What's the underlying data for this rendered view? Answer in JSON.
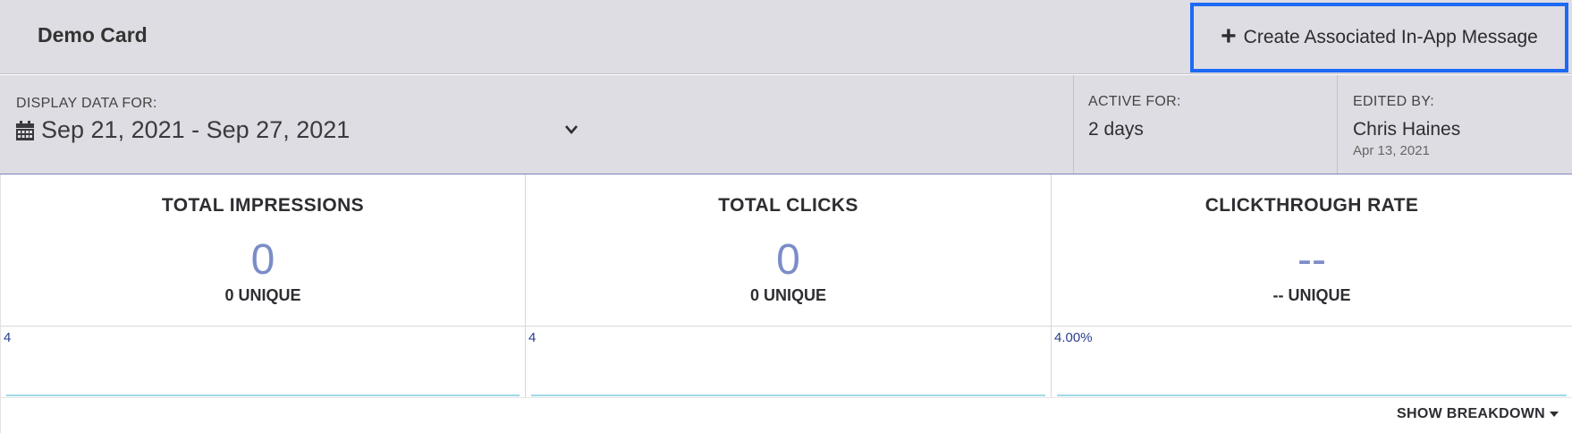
{
  "header": {
    "title": "Demo Card",
    "create_button_label": "Create Associated In-App Message"
  },
  "filters": {
    "display_label": "DISPLAY DATA FOR:",
    "date_range": "Sep 21, 2021 - Sep 27, 2021",
    "active_label": "ACTIVE FOR:",
    "active_value": "2 days",
    "edited_label": "EDITED BY:",
    "edited_name": "Chris Haines",
    "edited_date": "Apr 13, 2021"
  },
  "stats": [
    {
      "title": "TOTAL IMPRESSIONS",
      "value": "0",
      "unique": "0 UNIQUE",
      "chart_ymax": "4"
    },
    {
      "title": "TOTAL CLICKS",
      "value": "0",
      "unique": "0 UNIQUE",
      "chart_ymax": "4"
    },
    {
      "title": "CLICKTHROUGH RATE",
      "value": "--",
      "unique": "-- UNIQUE",
      "chart_ymax": "4.00%"
    }
  ],
  "footer": {
    "breakdown_label": "SHOW BREAKDOWN"
  },
  "colors": {
    "accent_border": "#1d6af5",
    "stat_value": "#7b8dc8",
    "chart_line": "#9fd8e6"
  }
}
